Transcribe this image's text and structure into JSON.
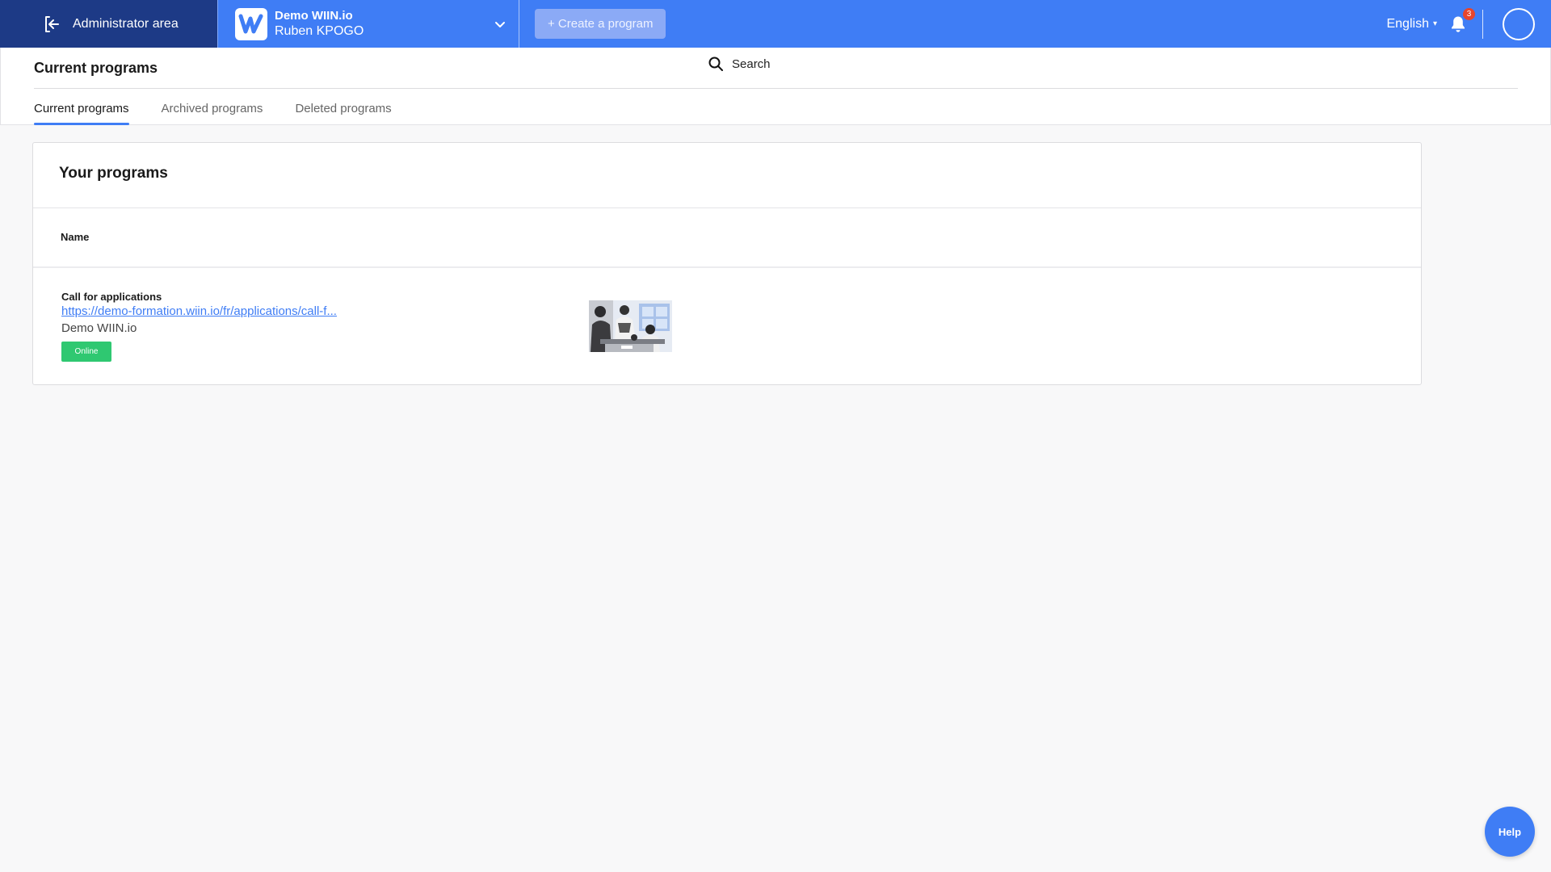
{
  "topbar": {
    "admin_area_label": "Administrator area",
    "admin_area_icon": "exit-arrow-icon",
    "org_name": "Demo WIIN.io",
    "org_user": "Ruben KPOGO",
    "org_logo_icon": "wiin-logo-icon",
    "org_dropdown_icon": "chevron-down-icon",
    "create_button_label": "+ Create a program",
    "language": "English",
    "notification_icon": "bell-icon",
    "notification_count": "3",
    "avatar_icon": "user-avatar"
  },
  "subheader": {
    "title": "Current programs",
    "search_label": "Search",
    "search_icon": "search-icon",
    "tabs": [
      {
        "label": "Current programs",
        "active": true
      },
      {
        "label": "Archived programs",
        "active": false
      },
      {
        "label": "Deleted programs",
        "active": false
      }
    ]
  },
  "programs": {
    "title": "Your programs",
    "column_name": "Name",
    "rows": [
      {
        "name": "Call for applications",
        "link": "https://demo-formation.wiin.io/fr/applications/call-f...",
        "organization": "Demo WIIN.io",
        "status": "Online"
      }
    ]
  },
  "help": {
    "label": "Help"
  },
  "colors": {
    "primary": "#3f7df5",
    "admin_bg": "#1d3a86",
    "online": "#2fc871",
    "notification_badge": "#e8452c"
  }
}
